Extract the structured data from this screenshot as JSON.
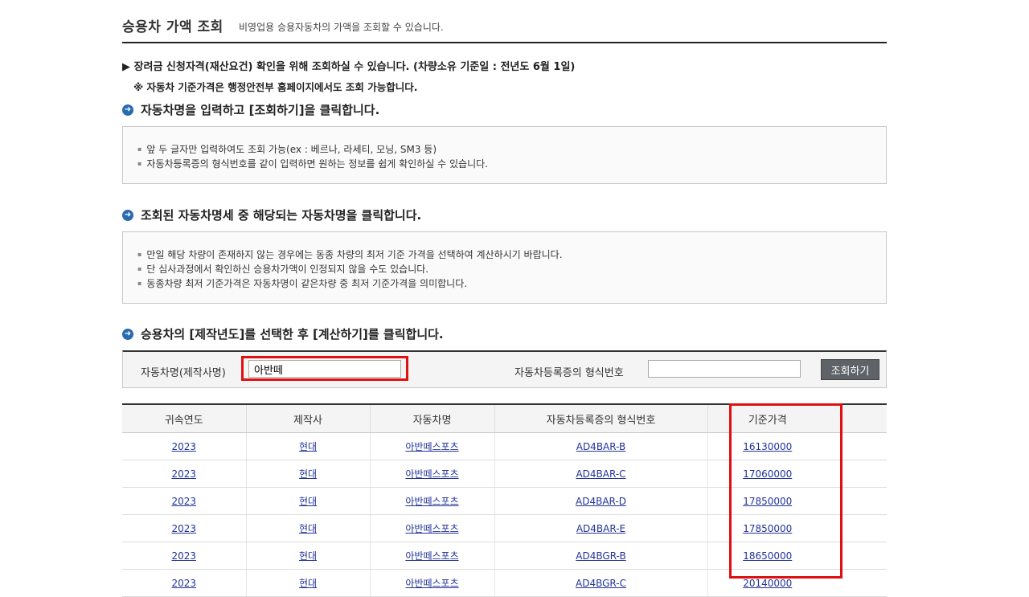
{
  "header": {
    "title": "승용차 가액 조회",
    "subtitle": "비영업용 승용자동차의 가액을 조회할 수 있습니다."
  },
  "notes": {
    "line1": "▶ 장려금 신청자격(재산요건) 확인을 위해 조회하실 수 있습니다. (차량소유 기준일 : 전년도 6월 1일)",
    "line2": "※ 자동차 기준가격은 행정안전부 홈페이지에서도 조회 가능합니다."
  },
  "sections": [
    {
      "title": "자동차명을 입력하고 [조회하기]을 클릭합니다.",
      "lines": [
        "앞 두 글자만 입력하여도 조회 가능(ex : 베르나, 라세티, 모닝, SM3 등)",
        "자동차등록증의 형식번호를 같이 입력하면 원하는 정보를 쉽게 확인하실 수 있습니다."
      ]
    },
    {
      "title": "조회된 자동차명세 중 해당되는 자동차명을 클릭합니다.",
      "lines": [
        "만일 해당 차량이 존재하지 않는 경우에는 동종 차량의 최저 기준 가격을 선택하여 계산하시기 바랍니다.",
        "단 심사과정에서 확인하신 승용차가액이 인정되지 않을 수도 있습니다.",
        "동종차량 최저 기준가격은 자동차명이 같은차량 중  최저 기준가격을 의미합니다."
      ]
    },
    {
      "title": "승용차의 [제작년도]를 선택한 후 [계산하기]를 클릭합니다."
    }
  ],
  "search": {
    "car_name_label": "자동차명(제작사명)",
    "car_name_value": "아반떼",
    "model_no_label": "자동차등록증의 형식번호",
    "model_no_value": "",
    "search_button": "조회하기"
  },
  "table": {
    "columns": [
      "귀속연도",
      "제작사",
      "자동차명",
      "자동차등록증의 형식번호",
      "기준가격"
    ],
    "rows": [
      [
        "2023",
        "현대",
        "아반떼스포츠",
        "AD4BAR-B",
        "16130000"
      ],
      [
        "2023",
        "현대",
        "아반떼스포츠",
        "AD4BAR-C",
        "17060000"
      ],
      [
        "2023",
        "현대",
        "아반떼스포츠",
        "AD4BAR-D",
        "17850000"
      ],
      [
        "2023",
        "현대",
        "아반떼스포츠",
        "AD4BAR-E",
        "17850000"
      ],
      [
        "2023",
        "현대",
        "아반떼스포츠",
        "AD4BGR-B",
        "18650000"
      ],
      [
        "2023",
        "현대",
        "아반떼스포츠",
        "AD4BGR-C",
        "20140000"
      ]
    ]
  },
  "colors": {
    "highlight": "#e01010",
    "accent": "#2a6bb0",
    "link": "#223399"
  }
}
